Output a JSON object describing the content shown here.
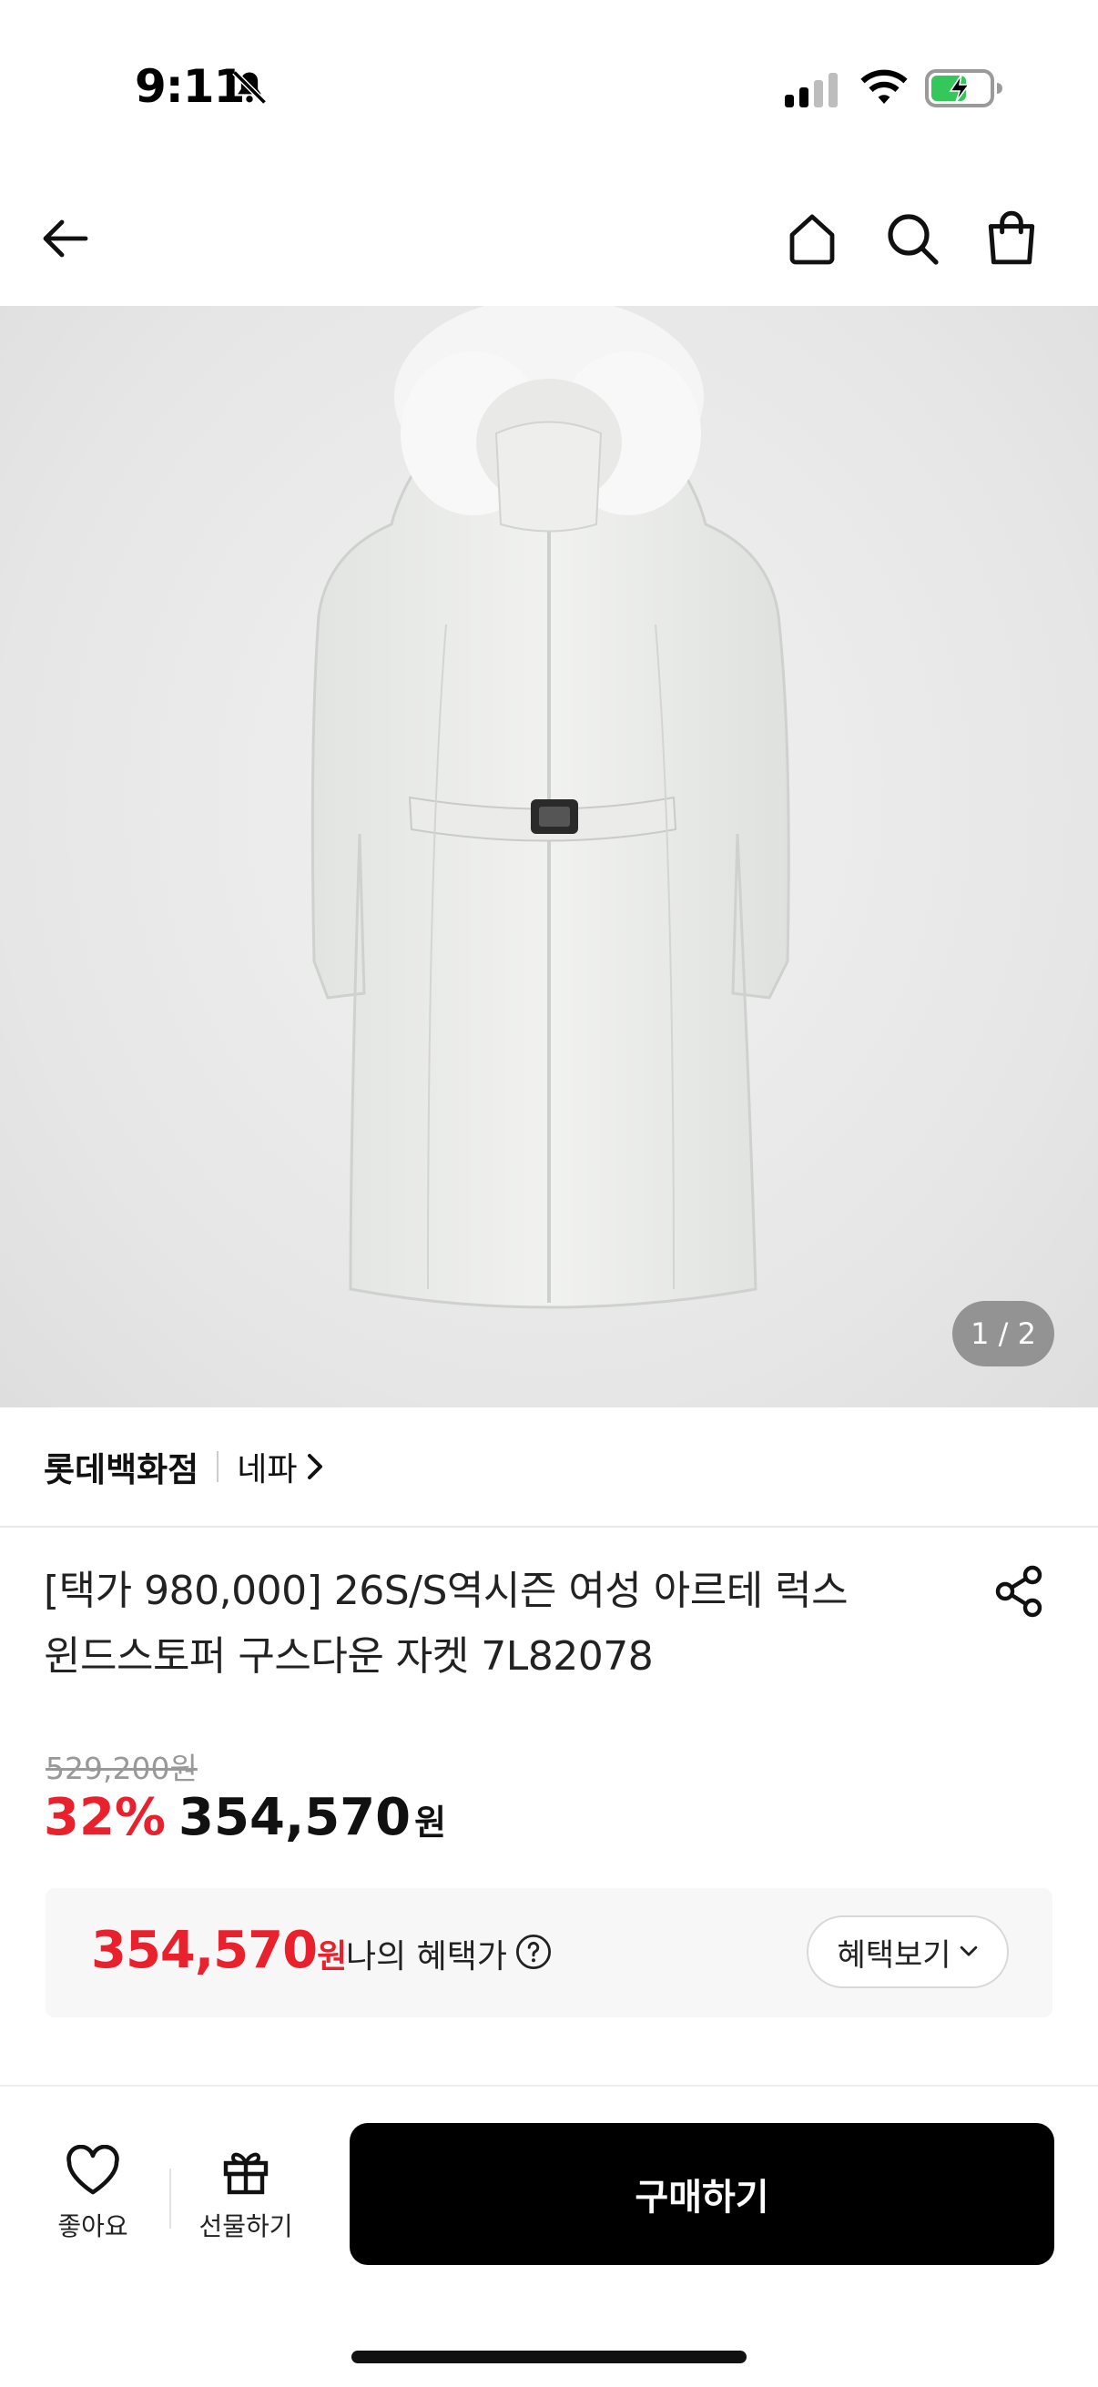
{
  "status_bar": {
    "time": "9:11"
  },
  "brand": {
    "main": "롯데백화점",
    "sub": "네파"
  },
  "product": {
    "title_line1": "[택가 980,000] 26S/S역시즌 여성 아르테 럭스",
    "title_line2": "윈드스토퍼 구스다운 자켓 7L82078",
    "image_counter": "1 / 2"
  },
  "price": {
    "original": "529,200원",
    "discount": "32%",
    "sale": "354,570",
    "unit": "원"
  },
  "benefit": {
    "price": "354,570",
    "unit": "원",
    "label": "나의 혜택가",
    "button_label": "혜택보기"
  },
  "bottom_bar": {
    "like_label": "좋아요",
    "gift_label": "선물하기",
    "buy_label": "구매하기"
  },
  "colors": {
    "accent_red": "#e8212c",
    "buy_button": "#000000"
  }
}
